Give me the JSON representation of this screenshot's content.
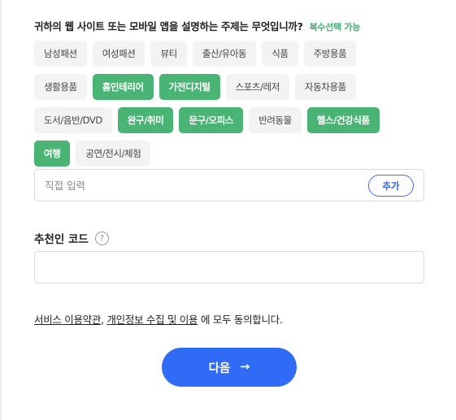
{
  "question": {
    "text": "귀하의 웹 사이트 또는 모바일 앱을 설명하는 주제는 무엇입니까?",
    "multi_label": "복수선택 가능"
  },
  "topics": [
    [
      {
        "label": "남성패션",
        "selected": false
      },
      {
        "label": "여성패션",
        "selected": false
      },
      {
        "label": "뷰티",
        "selected": false
      },
      {
        "label": "출산/유아동",
        "selected": false
      },
      {
        "label": "식품",
        "selected": false
      },
      {
        "label": "주방용품",
        "selected": false
      }
    ],
    [
      {
        "label": "생활용품",
        "selected": false
      },
      {
        "label": "홈인테리어",
        "selected": true
      },
      {
        "label": "가전디지털",
        "selected": true
      },
      {
        "label": "스포츠/레저",
        "selected": false
      },
      {
        "label": "자동차용품",
        "selected": false
      }
    ],
    [
      {
        "label": "도서/음반/DVD",
        "selected": false
      },
      {
        "label": "완구/취미",
        "selected": true
      },
      {
        "label": "문구/오피스",
        "selected": true
      },
      {
        "label": "반려동물",
        "selected": false
      },
      {
        "label": "헬스/건강식품",
        "selected": true
      }
    ],
    [
      {
        "label": "여행",
        "selected": true
      },
      {
        "label": "공연/전시/체험",
        "selected": false
      }
    ]
  ],
  "custom_input": {
    "placeholder": "직접 입력",
    "value": "",
    "add_label": "추가"
  },
  "referral": {
    "label": "추천인 코드",
    "help_glyph": "?",
    "value": ""
  },
  "agreement": {
    "terms_link": "서비스 이용약관",
    "separator": ", ",
    "privacy_link": "개인정보 수집 및 이용",
    "suffix": " 에 모두 동의합니다."
  },
  "next_button": {
    "label": "다음",
    "arrow": "→"
  },
  "colors": {
    "selected_chip": "#49b474",
    "primary_button": "#2f6bf5"
  }
}
